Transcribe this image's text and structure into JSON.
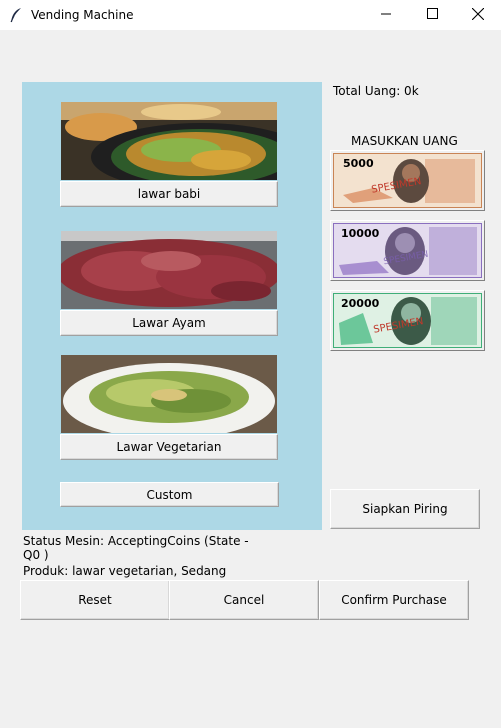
{
  "window": {
    "title": "Vending Machine",
    "app_icon": "feather-icon",
    "controls": [
      "minimize-icon",
      "maximize-icon",
      "close-icon"
    ]
  },
  "products": [
    {
      "label": "lawar babi",
      "image": "lawar-babi-photo"
    },
    {
      "label": "Lawar Ayam",
      "image": "lawar-ayam-photo"
    },
    {
      "label": "Lawar Vegetarian",
      "image": "lawar-vegetarian-photo"
    }
  ],
  "custom_label": "Custom",
  "total": "Total Uang: 0k",
  "money_title": "MASUKKAN UANG",
  "banknotes": [
    {
      "amount": "5000",
      "specimen": "SPESIMEN",
      "color": "#d98a5a"
    },
    {
      "amount": "10000",
      "specimen": "SPESIMEN",
      "color": "#8a6fbf"
    },
    {
      "amount": "20000",
      "specimen": "SPESIMEN",
      "color": "#3fae78"
    }
  ],
  "siapkan_label": "Siapkan Piring",
  "status": "Status Mesin: AcceptingCoins (State - Q0 )",
  "produk": "Produk: lawar vegetarian, Sedang",
  "actions": {
    "reset": "Reset",
    "cancel": "Cancel",
    "confirm": "Confirm Purchase"
  },
  "colors": {
    "panel": "#add8e6",
    "background": "#f0f0f0"
  }
}
